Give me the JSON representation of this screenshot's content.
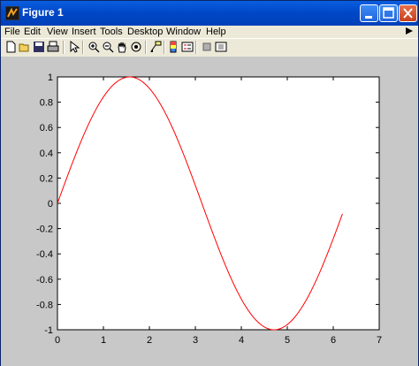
{
  "window": {
    "title": "Figure 1",
    "controls": {
      "minimize_icon": "minimize-icon",
      "maximize_icon": "maximize-icon",
      "close_icon": "close-icon"
    }
  },
  "menubar": {
    "items": [
      {
        "label": "File"
      },
      {
        "label": "Edit"
      },
      {
        "label": "View"
      },
      {
        "label": "Insert"
      },
      {
        "label": "Tools"
      },
      {
        "label": "Desktop"
      },
      {
        "label": "Window"
      },
      {
        "label": "Help"
      }
    ]
  },
  "toolbar": {
    "buttons": [
      {
        "icon": "new-figure-icon"
      },
      {
        "icon": "open-file-icon"
      },
      {
        "icon": "save-icon"
      },
      {
        "icon": "print-icon"
      },
      {
        "icon": "edit-plot-arrow-icon"
      },
      {
        "icon": "zoom-in-icon"
      },
      {
        "icon": "zoom-out-icon"
      },
      {
        "icon": "pan-hand-icon"
      },
      {
        "icon": "rotate-3d-icon"
      },
      {
        "icon": "data-cursor-icon"
      },
      {
        "icon": "insert-colorbar-icon"
      },
      {
        "icon": "insert-legend-icon"
      },
      {
        "icon": "hide-plot-tools-icon"
      },
      {
        "icon": "show-plot-tools-icon"
      }
    ]
  },
  "chart_data": {
    "type": "line",
    "title": "",
    "xlabel": "",
    "ylabel": "",
    "xlim": [
      0,
      7
    ],
    "ylim": [
      -1,
      1
    ],
    "x_ticks": [
      "0",
      "1",
      "2",
      "3",
      "4",
      "5",
      "6",
      "7"
    ],
    "y_ticks": [
      "1",
      "0.8",
      "0.6",
      "0.4",
      "0.2",
      "0",
      "-0.2",
      "-0.4",
      "-0.6",
      "-0.8",
      "-1"
    ],
    "series": [
      {
        "function": "sin(x)",
        "color": "#ff0000",
        "x_range": [
          0,
          6.2
        ]
      }
    ],
    "grid": false,
    "legend": "none"
  },
  "colors": {
    "figure_background": "#c8c8c8",
    "axes_background": "#ffffff",
    "line": "#ff0000"
  }
}
